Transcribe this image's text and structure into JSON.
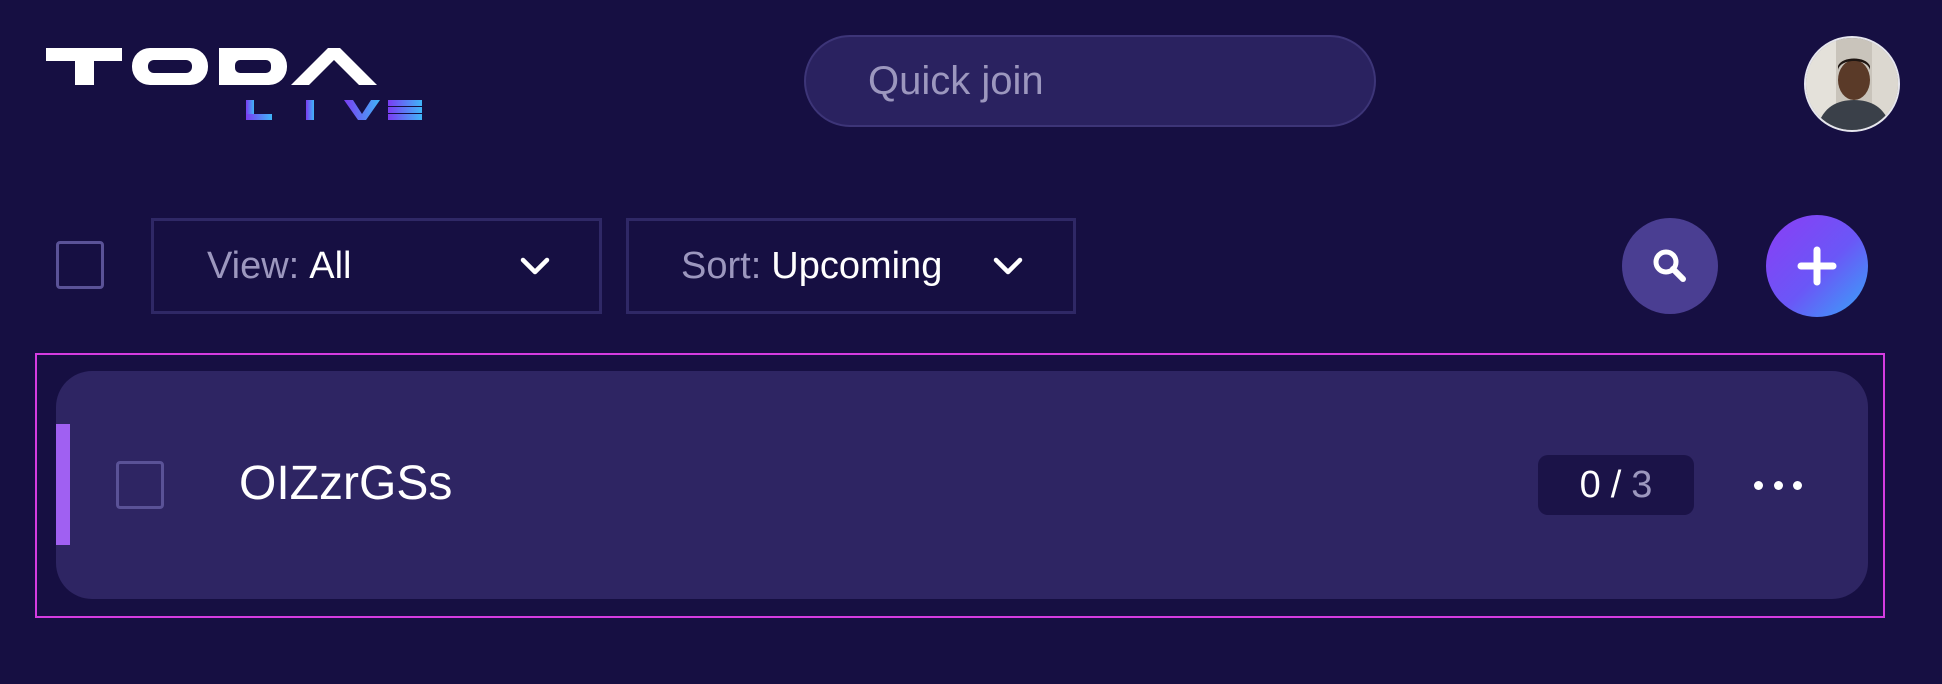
{
  "header": {
    "logo": {
      "text": "TODA",
      "sub": "LIVE"
    },
    "quick_join": {
      "placeholder": "Quick join",
      "value": ""
    }
  },
  "toolbar": {
    "view": {
      "key": "View:",
      "value": "All"
    },
    "sort": {
      "key": "Sort:",
      "value": "Upcoming"
    }
  },
  "rooms": [
    {
      "name": "OIZzrGSs",
      "filled": "0",
      "separator": "/",
      "total": "3"
    }
  ],
  "colors": {
    "background": "#160f42",
    "card": "#2e2563",
    "accent": "#a060f2",
    "selection_outline": "#d43ce0",
    "add_button_gradient": [
      "#8b3df5",
      "#36a6f8"
    ]
  },
  "icons": {
    "view_chevron": "chevron-down-icon",
    "sort_chevron": "chevron-down-icon",
    "search": "search-icon",
    "add": "plus-icon",
    "more": "more-horizontal-icon"
  }
}
